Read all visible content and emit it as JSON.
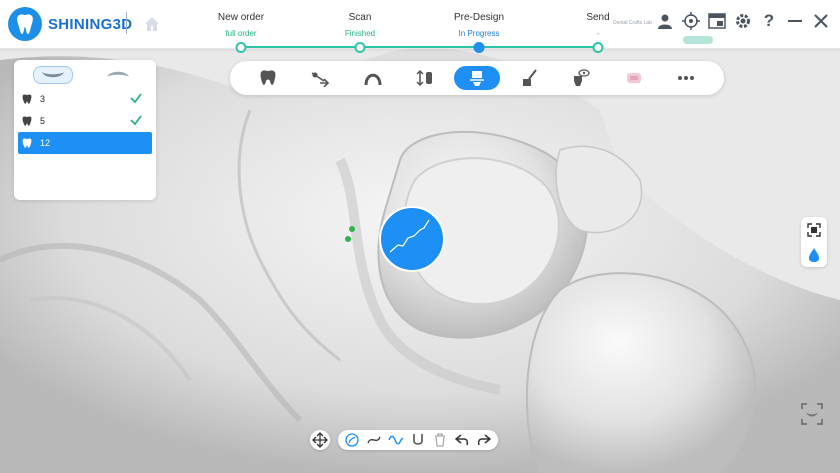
{
  "brand": {
    "name": "SHINING3D"
  },
  "workflow": {
    "steps": [
      {
        "title": "New order",
        "status": "full order",
        "status_color": "#27b37f"
      },
      {
        "title": "Scan",
        "status": "Finished",
        "status_color": "#27b37f"
      },
      {
        "title": "Pre-Design",
        "status": "In Progress",
        "status_color": "#1e7fe0"
      },
      {
        "title": "Send",
        "status": "-",
        "status_color": "#888888"
      }
    ],
    "line_color": "#2ec4a7"
  },
  "header_right": {
    "lab_name": "Dental Crafts Lab",
    "icons": [
      "user-icon",
      "target-icon",
      "window-icon",
      "gear-icon",
      "help-icon",
      "minimize-icon",
      "close-icon"
    ]
  },
  "tooth_panel": {
    "tabs": [
      {
        "name": "upper-jaw-tab",
        "active": true
      },
      {
        "name": "lower-jaw-tab",
        "active": false
      }
    ],
    "teeth": [
      {
        "number": "3",
        "done": true,
        "active": false
      },
      {
        "number": "5",
        "done": true,
        "active": false
      },
      {
        "number": "12",
        "done": false,
        "active": true
      }
    ]
  },
  "toolbar": {
    "tools": [
      {
        "icon": "tooth-icon",
        "active": false
      },
      {
        "icon": "insertion-axis-icon",
        "active": false
      },
      {
        "icon": "arch-icon",
        "active": false
      },
      {
        "icon": "adjust-tooth-icon",
        "active": false
      },
      {
        "icon": "margin-line-icon",
        "active": true
      },
      {
        "icon": "brush-icon",
        "active": false
      },
      {
        "icon": "view-tooth-icon",
        "active": false
      },
      {
        "icon": "crown-preview-icon",
        "active": false
      },
      {
        "icon": "more-icon",
        "active": false
      }
    ]
  },
  "accent_color": "#1e90f5",
  "bottom_toolbar": {
    "icons": [
      "move-icon",
      "draw-curve-icon",
      "smooth-icon",
      "wave-icon",
      "magnet-icon",
      "delete-icon",
      "undo-icon",
      "redo-icon"
    ]
  },
  "side_widgets": {
    "icons": [
      "fit-view-icon",
      "water-drop-icon"
    ],
    "bottom_icon": "screenshot-icon"
  }
}
